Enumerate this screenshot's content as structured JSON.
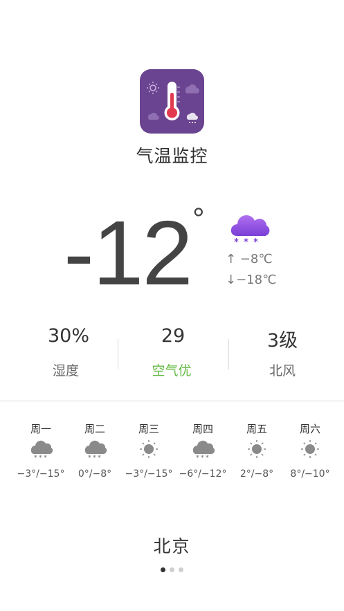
{
  "app": {
    "name": "气温监控",
    "icon": "thermometer-app-icon",
    "icon_bg": "#6b4491"
  },
  "current": {
    "temperature": "-12",
    "unit": "°",
    "condition_icon": "snow-cloud-icon",
    "condition_color": "#8a48e0",
    "high": "↑ −8℃",
    "low": "↓−18℃"
  },
  "stats": [
    {
      "value": "30%",
      "label": "湿度"
    },
    {
      "value": "29",
      "label": "空气优",
      "color": "#66bb44"
    },
    {
      "value": "3级",
      "label": "北风"
    }
  ],
  "forecast": [
    {
      "day": "周一",
      "icon": "snow-cloud-icon",
      "range": "−3°/−15°"
    },
    {
      "day": "周二",
      "icon": "snow-cloud-icon",
      "range": "0°/−8°"
    },
    {
      "day": "周三",
      "icon": "sun-icon",
      "range": "−3°/−15°"
    },
    {
      "day": "周四",
      "icon": "snow-cloud-icon",
      "range": "−6°/−12°"
    },
    {
      "day": "周五",
      "icon": "sun-icon",
      "range": "2°/−8°"
    },
    {
      "day": "周六",
      "icon": "sun-icon",
      "range": "8°/−10°"
    }
  ],
  "city": "北京",
  "pager": {
    "count": 3,
    "active": 0
  }
}
